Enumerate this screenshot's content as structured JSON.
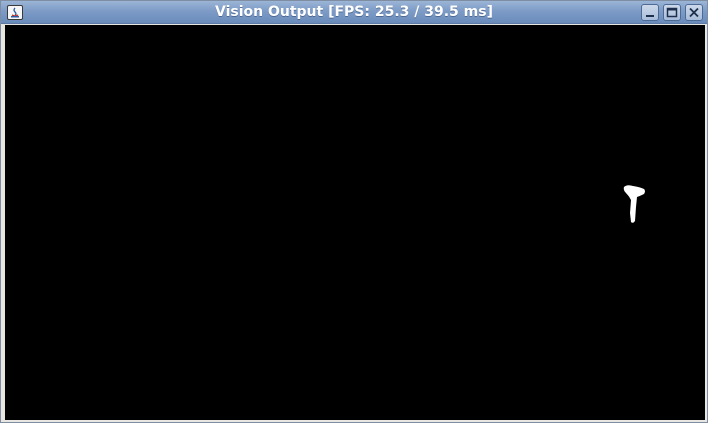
{
  "window": {
    "title": "Vision Output [FPS: 25.3 / 39.5 ms]",
    "controls": [
      "minimize-icon",
      "maximize-icon",
      "close-icon"
    ]
  },
  "viewport": {
    "background": "#000000",
    "detection_color": "#ffffff"
  }
}
